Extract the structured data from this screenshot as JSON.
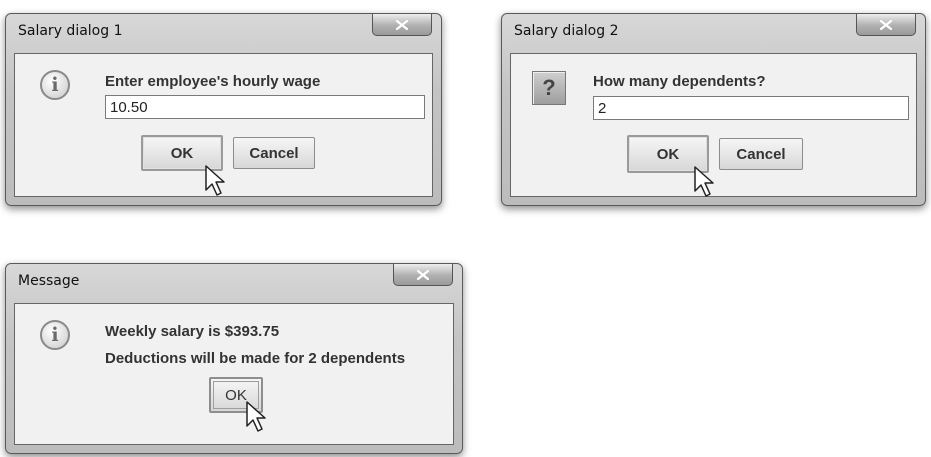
{
  "dialogs": {
    "wage": {
      "title": "Salary dialog 1",
      "close_symbol": "x",
      "icon": "info-icon",
      "prompt": "Enter employee's hourly wage",
      "input_value": "10.50",
      "ok_label": "OK",
      "cancel_label": "Cancel"
    },
    "dependents": {
      "title": "Salary dialog 2",
      "close_symbol": "x",
      "icon": "question-icon",
      "prompt": "How many dependents?",
      "input_value": "2",
      "ok_label": "OK",
      "cancel_label": "Cancel"
    },
    "message": {
      "title": "Message",
      "close_symbol": "x",
      "icon": "info-icon",
      "line1": "Weekly salary is $393.75",
      "line2": "Deductions will be made for 2 dependents",
      "ok_label": "OK"
    }
  },
  "icons": {
    "info_glyph": "i",
    "question_glyph": "?"
  }
}
